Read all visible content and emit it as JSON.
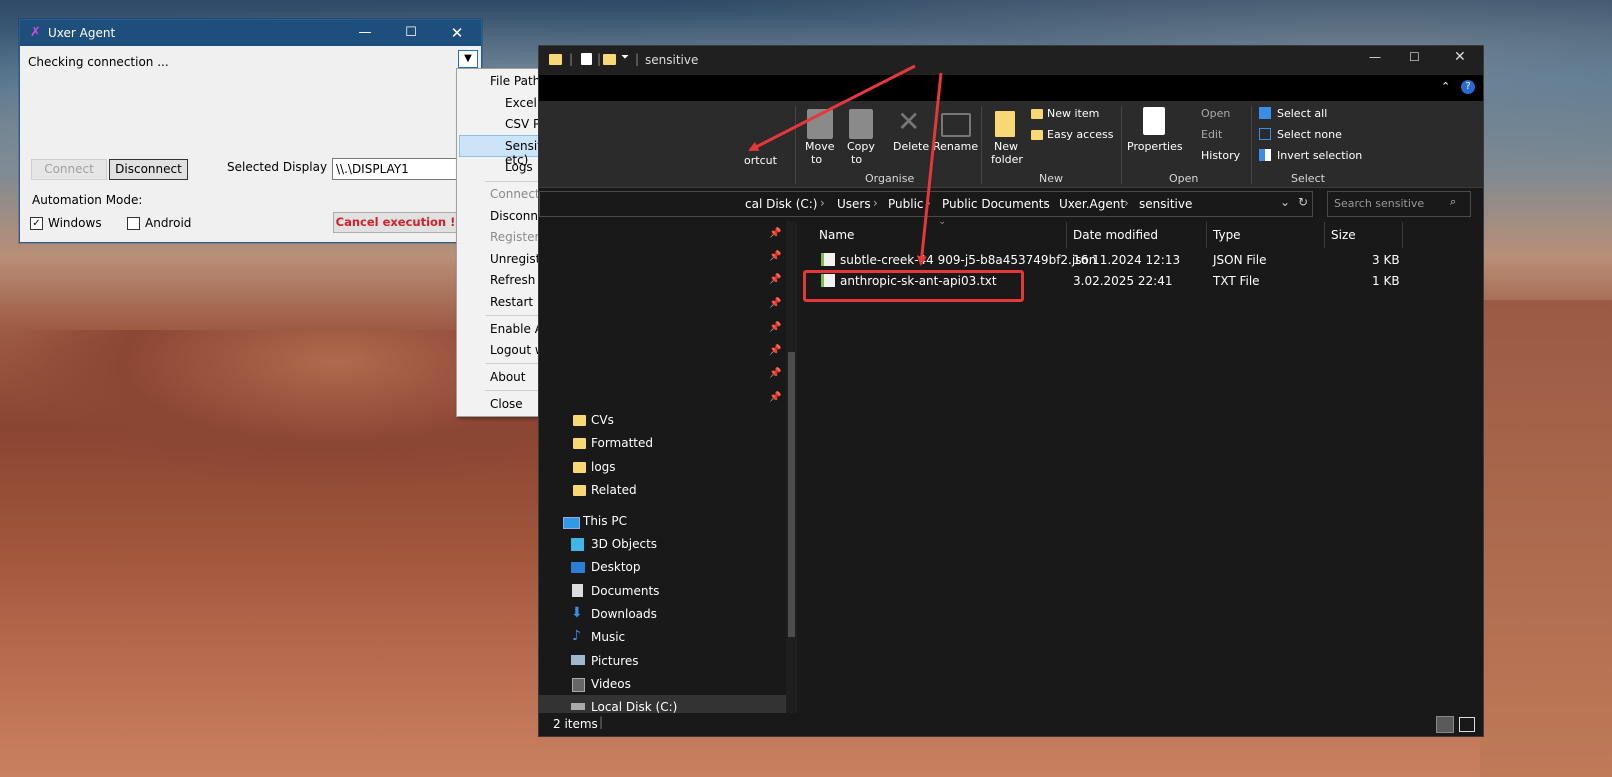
{
  "agent": {
    "title": "Uxer Agent",
    "status": "Checking connection ...",
    "connect": "Connect",
    "disconnect": "Disconnect",
    "selected_display_label": "Selected Display",
    "selected_display_value": "\\\\.\\DISPLAY1",
    "automation_mode_label": "Automation Mode:",
    "windows": "Windows",
    "android": "Android",
    "cancel": "Cancel execution !",
    "dropdown_icon": "triangle-down-icon"
  },
  "menu": {
    "file_paths": "File Paths",
    "excel_path": "Excel Path",
    "csv_path": "CSV Path",
    "sensitive": "Sensitive Data Path (Keys, Credentials etc)",
    "logs": "Logs",
    "connect": "Connect",
    "disconnect": "Disconnect",
    "register": "Register",
    "unregister": "Unregister",
    "refresh_token": "Refresh Token",
    "restart": "Restart",
    "enable_autostart": "Enable AutoStart",
    "logout": "Logout without locking",
    "about": "About",
    "close": "Close"
  },
  "explorer": {
    "title": "sensitive",
    "ribbon": {
      "shortcut": "ortcut",
      "move_to": "Move",
      "move_to2": "to",
      "copy_to": "Copy",
      "copy_to2": "to",
      "delete": "Delete",
      "rename": "Rename",
      "organise": "Organise",
      "new_folder": "New",
      "new_folder2": "folder",
      "new_item": "New item",
      "easy_access": "Easy access",
      "new": "New",
      "properties": "Properties",
      "open": "Open",
      "edit": "Edit",
      "history": "History",
      "open_group": "Open",
      "select_all": "Select all",
      "select_none": "Select none",
      "invert_selection": "Invert selection",
      "select_group": "Select"
    },
    "breadcrumb": [
      "cal Disk (C:)",
      "Users",
      "Public",
      "Public Documents",
      "Uxer.Agent",
      "sensitive"
    ],
    "search_placeholder": "Search sensitive",
    "columns": {
      "name": "Name",
      "date": "Date modified",
      "type": "Type",
      "size": "Size"
    },
    "files": [
      {
        "name": "subtle-creek-44 909-j5-b8a453749bf2.json",
        "date": "16.11.2024 12:13",
        "type": "JSON File",
        "size": "3 KB"
      },
      {
        "name": "anthropic-sk-ant-api03.txt",
        "date": "3.02.2025 22:41",
        "type": "TXT File",
        "size": "1 KB"
      }
    ],
    "nav": {
      "cvs": "CVs",
      "formatted": "Formatted",
      "logs": "logs",
      "related": "Related",
      "this_pc": "This PC",
      "objects3d": "3D Objects",
      "desktop": "Desktop",
      "documents": "Documents",
      "downloads": "Downloads",
      "music": "Music",
      "pictures": "Pictures",
      "videos": "Videos",
      "local_disk": "Local Disk (C:)"
    },
    "status_items": "2 items"
  },
  "colors": {
    "highlight_red": "#e5383b",
    "titlebar": "#1e4f7c",
    "menu_highlight": "#cce4f7"
  }
}
